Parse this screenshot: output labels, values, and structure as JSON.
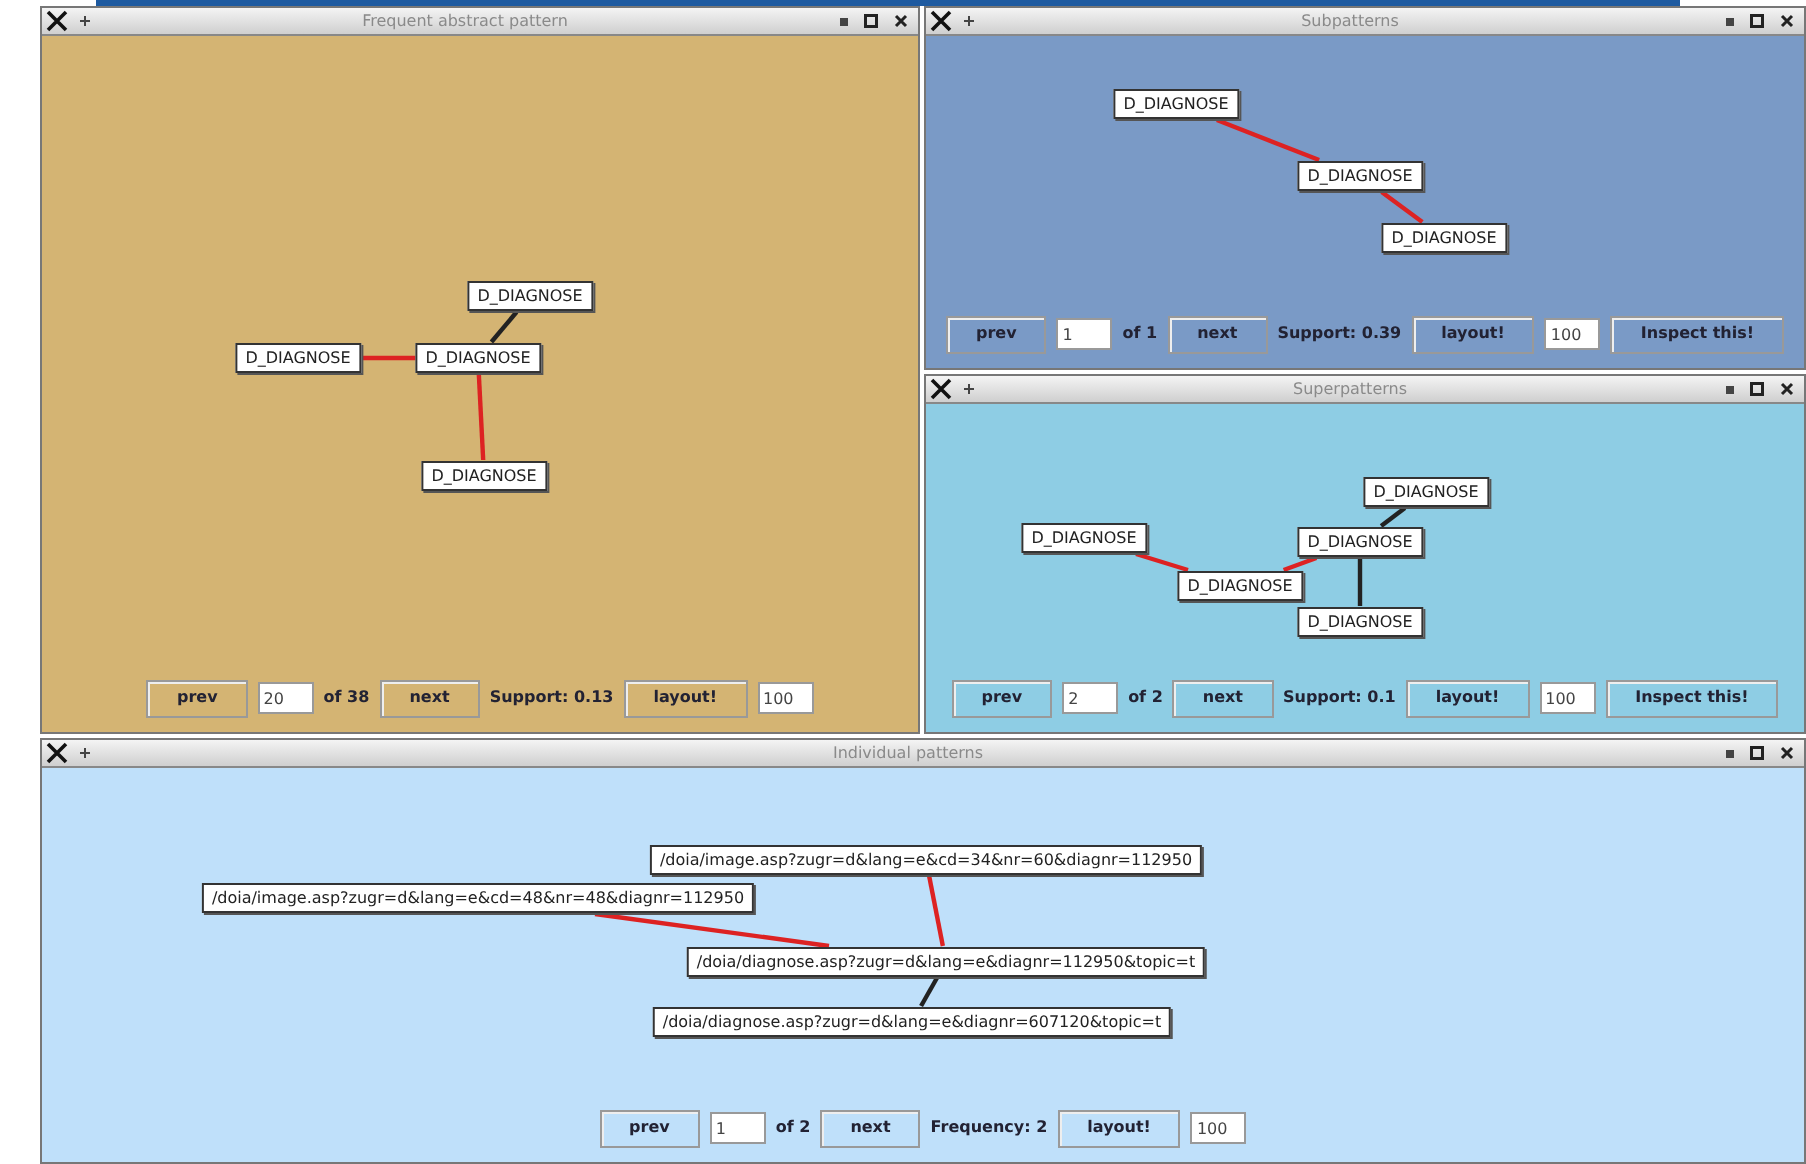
{
  "windows": [
    {
      "kind": "main",
      "title": "Frequent abstract pattern",
      "nodes": [
        {
          "label": "D_DIAGNOSE"
        },
        {
          "label": "D_DIAGNOSE"
        },
        {
          "label": "D_DIAGNOSE"
        },
        {
          "label": "D_DIAGNOSE"
        }
      ],
      "edges": [
        {
          "color": "#222222"
        },
        {
          "color": "#dd2222"
        },
        {
          "color": "#dd2222"
        }
      ],
      "controls": [
        {
          "kind": "button",
          "text": "prev"
        },
        {
          "kind": "field",
          "text": "20"
        },
        {
          "kind": "label",
          "text": "of 38"
        },
        {
          "kind": "button",
          "text": "next"
        },
        {
          "kind": "label",
          "text": "Support: 0.13"
        },
        {
          "kind": "button",
          "text": "layout!"
        },
        {
          "kind": "field",
          "text": "100"
        }
      ]
    },
    {
      "kind": "sub",
      "title": "Subpatterns",
      "nodes": [
        {
          "label": "D_DIAGNOSE"
        },
        {
          "label": "D_DIAGNOSE"
        },
        {
          "label": "D_DIAGNOSE"
        }
      ],
      "edges": [
        {
          "color": "#dd2222"
        },
        {
          "color": "#dd2222"
        }
      ],
      "controls": [
        {
          "kind": "button",
          "text": "prev"
        },
        {
          "kind": "field",
          "text": "1"
        },
        {
          "kind": "label",
          "text": "of 1"
        },
        {
          "kind": "button",
          "text": "next"
        },
        {
          "kind": "label",
          "text": "Support: 0.39"
        },
        {
          "kind": "button",
          "text": "layout!"
        },
        {
          "kind": "field",
          "text": "100"
        },
        {
          "kind": "button",
          "text": "Inspect this!"
        }
      ]
    },
    {
      "kind": "super",
      "title": "Superpatterns",
      "nodes": [
        {
          "label": "D_DIAGNOSE"
        },
        {
          "label": "D_DIAGNOSE"
        },
        {
          "label": "D_DIAGNOSE"
        },
        {
          "label": "D_DIAGNOSE"
        },
        {
          "label": "D_DIAGNOSE"
        }
      ],
      "edges": [
        {
          "color": "#dd2222"
        },
        {
          "color": "#dd2222"
        },
        {
          "color": "#222222"
        },
        {
          "color": "#222222"
        }
      ],
      "controls": [
        {
          "kind": "button",
          "text": "prev"
        },
        {
          "kind": "field",
          "text": "2"
        },
        {
          "kind": "label",
          "text": "of 2"
        },
        {
          "kind": "button",
          "text": "next"
        },
        {
          "kind": "label",
          "text": "Support: 0.1"
        },
        {
          "kind": "button",
          "text": "layout!"
        },
        {
          "kind": "field",
          "text": "100"
        },
        {
          "kind": "button",
          "text": "Inspect this!"
        }
      ]
    },
    {
      "kind": "individual",
      "title": "Individual patterns",
      "nodes": [
        {
          "label": "/doia/image.asp?zugr=d&lang=e&cd=34&nr=60&diagnr=112950"
        },
        {
          "label": "/doia/image.asp?zugr=d&lang=e&cd=48&nr=48&diagnr=112950"
        },
        {
          "label": "/doia/diagnose.asp?zugr=d&lang=e&diagnr=112950&topic=t"
        },
        {
          "label": "/doia/diagnose.asp?zugr=d&lang=e&diagnr=607120&topic=t"
        }
      ],
      "edges": [
        {
          "color": "#dd2222"
        },
        {
          "color": "#dd2222"
        },
        {
          "color": "#222222"
        }
      ],
      "controls": [
        {
          "kind": "button",
          "text": "prev"
        },
        {
          "kind": "field",
          "text": "1"
        },
        {
          "kind": "label",
          "text": "of 2"
        },
        {
          "kind": "button",
          "text": "next"
        },
        {
          "kind": "label",
          "text": "Frequency: 2"
        },
        {
          "kind": "button",
          "text": "layout!"
        },
        {
          "kind": "field",
          "text": "100"
        }
      ]
    }
  ]
}
